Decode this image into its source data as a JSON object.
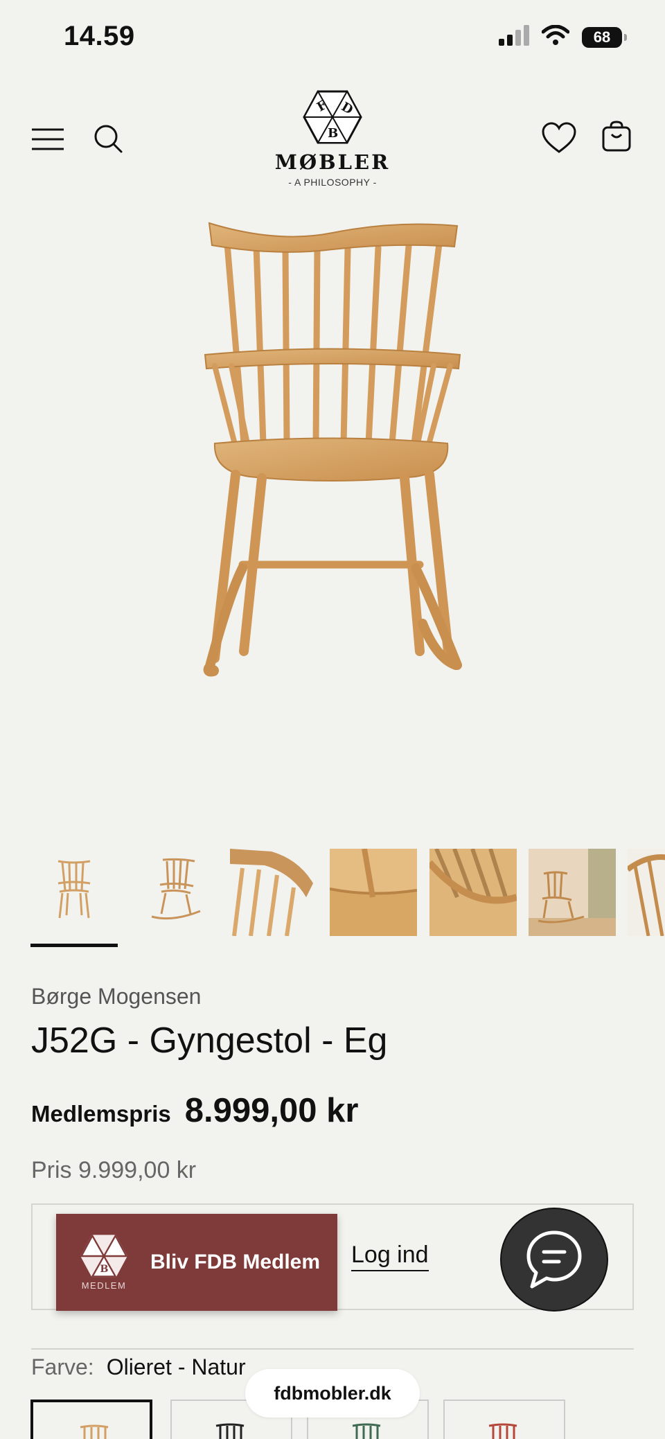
{
  "status_bar": {
    "time": "14.59",
    "battery": "68"
  },
  "header": {
    "brand_word": "MØBLER",
    "brand_tagline": "- A PHILOSOPHY -",
    "logo_letters": "FDB"
  },
  "product": {
    "designer": "Børge Mogensen",
    "title": "J52G - Gyngestol - Eg",
    "member_price_label": "Medlemspris",
    "member_price": "8.999,00 kr",
    "regular_price": "Pris 9.999,00 kr",
    "thumbnail_count": 7,
    "active_thumbnail": 0
  },
  "membership": {
    "join_label": "Bliv FDB Medlem",
    "join_logo_text": "MEDLEM",
    "login_label": "Log ind"
  },
  "color": {
    "label": "Farve:",
    "value": "Olieret - Natur",
    "swatches": [
      "natural-oak",
      "black",
      "green",
      "red"
    ]
  },
  "browser": {
    "url": "fdbmobler.dk"
  },
  "colors": {
    "background": "#f2f2ee",
    "wood": "#d9a86a",
    "member_red": "#7f3a3a",
    "chat_dark": "#333333"
  }
}
